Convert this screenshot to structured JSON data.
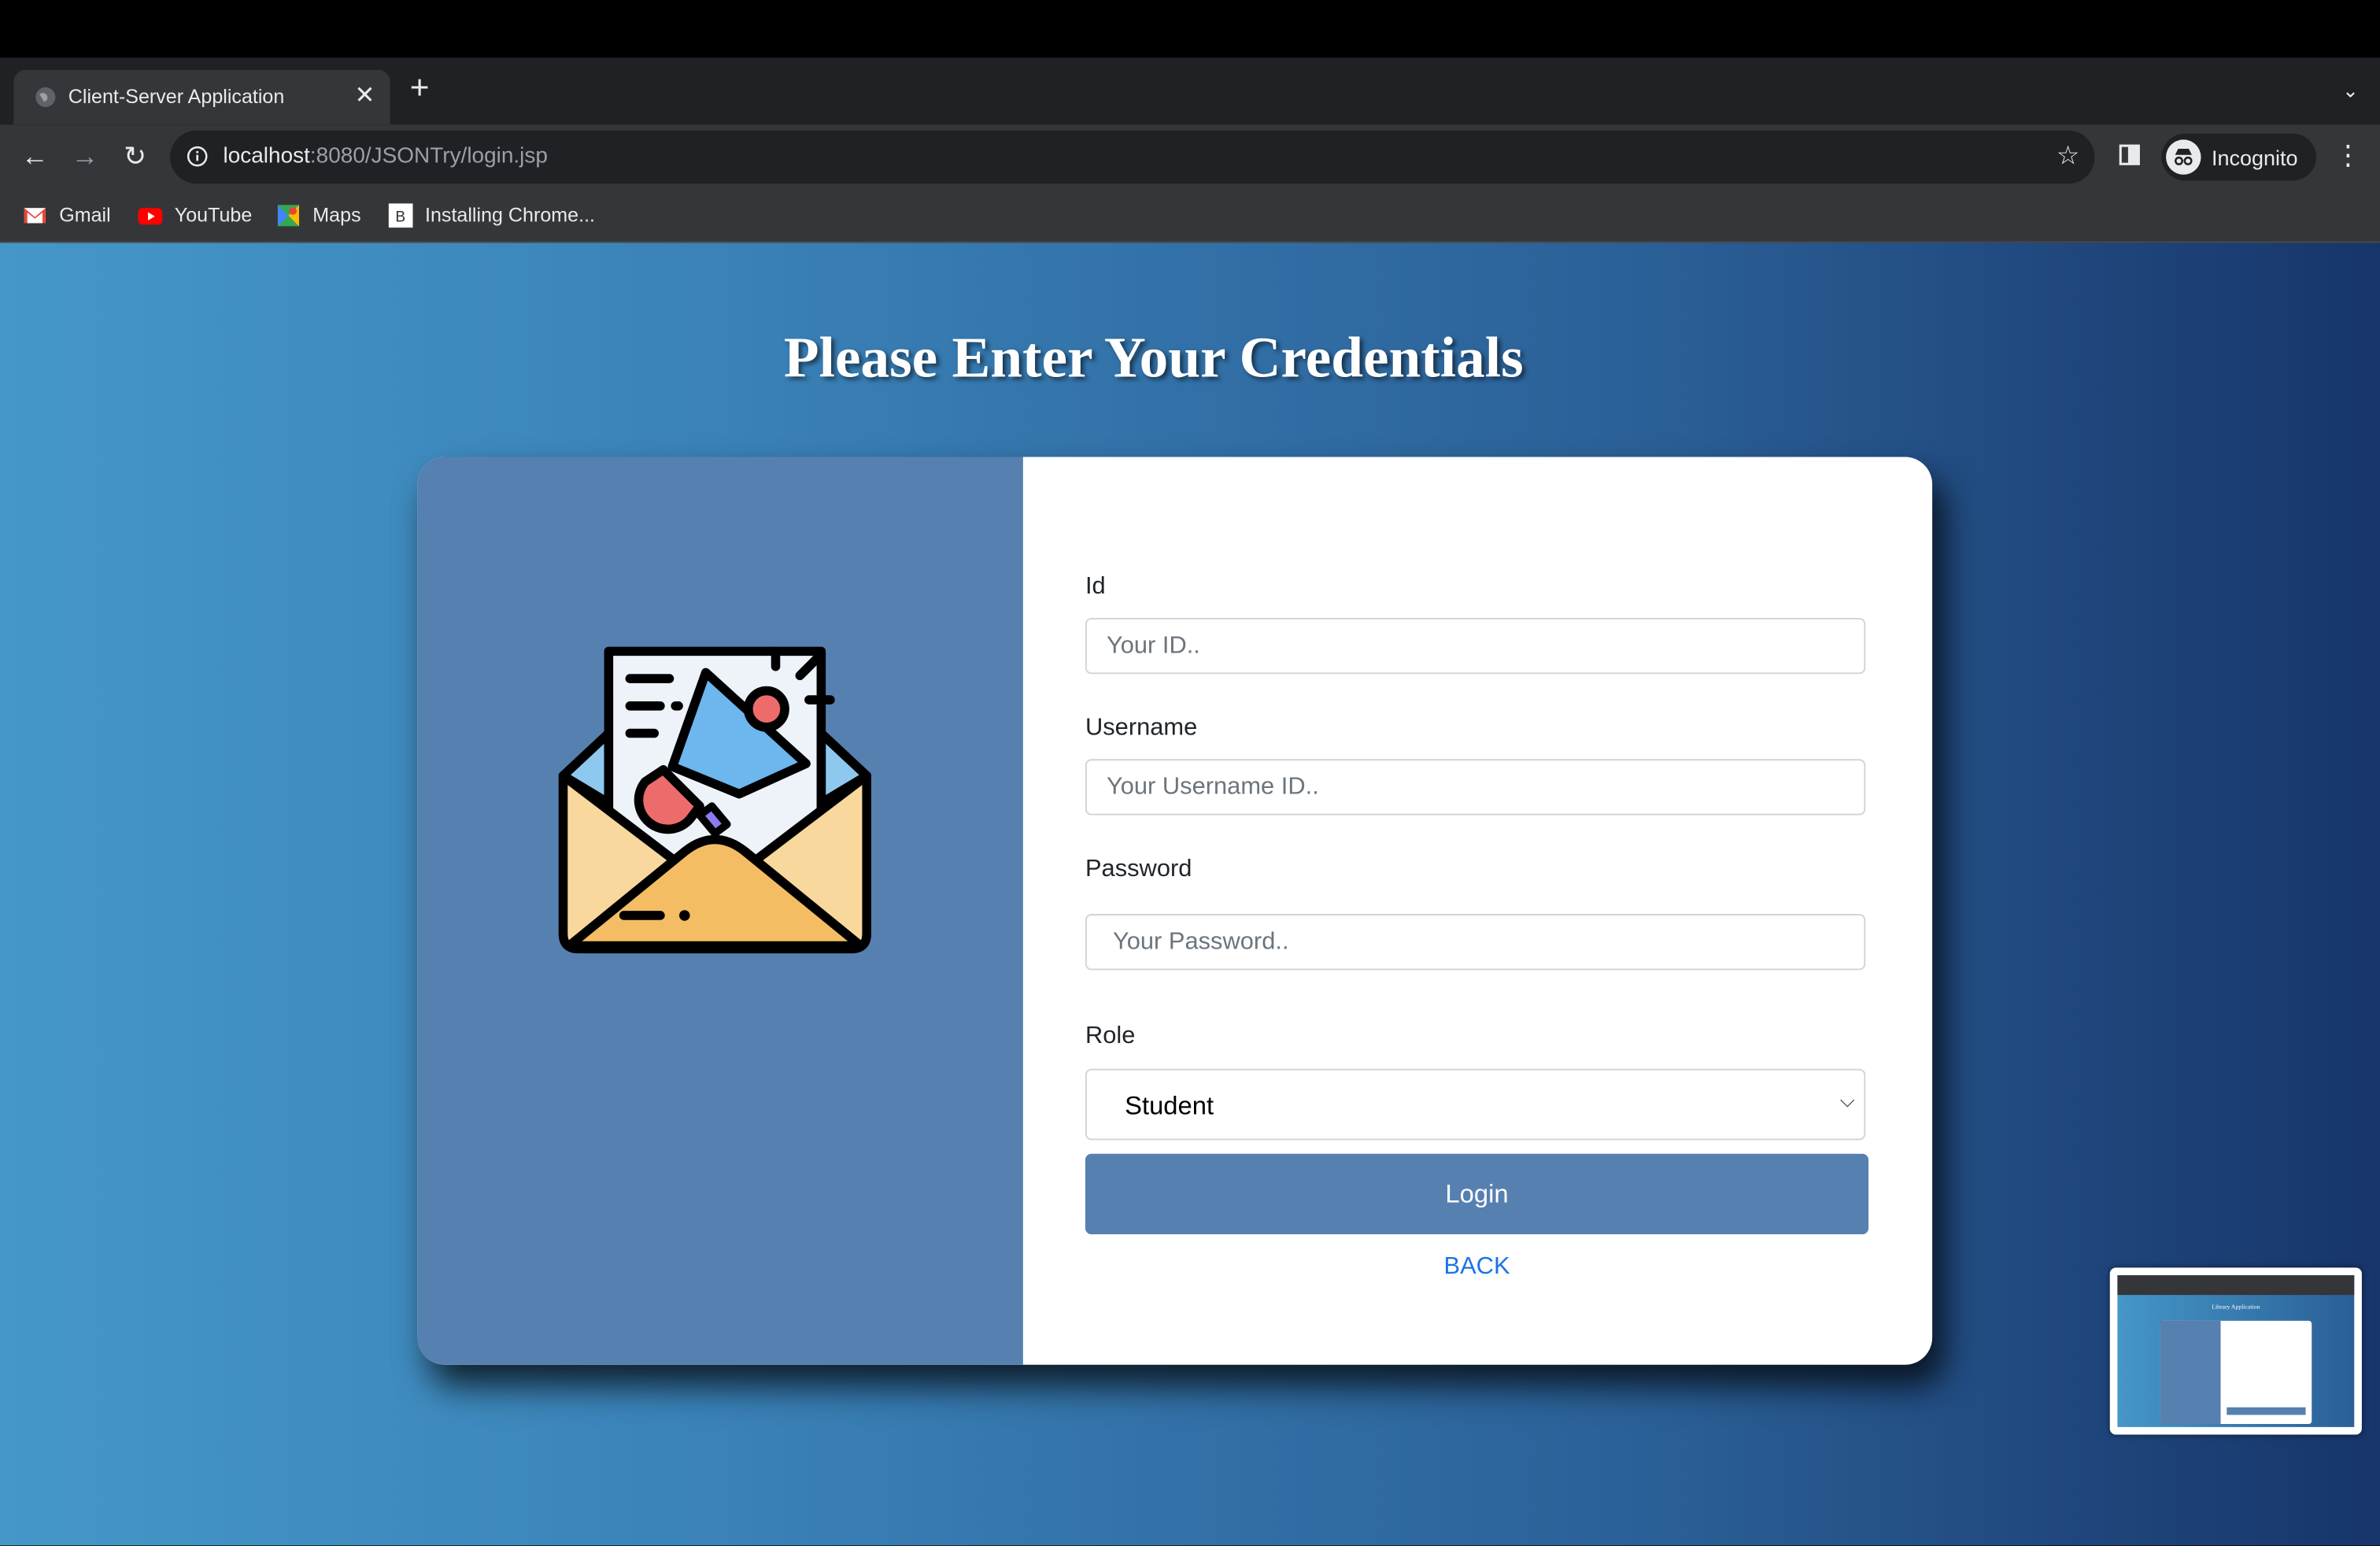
{
  "browser": {
    "tab_title": "Client-Server Application",
    "tab_close": "✕",
    "new_tab": "+",
    "tab_list": "⌄",
    "nav": {
      "back": "←",
      "forward": "→",
      "reload": "↻"
    },
    "url_host": "localhost",
    "url_path": ":8080/JSONTry/login.jsp",
    "star": "☆",
    "profile_label": "Incognito",
    "menu": "⋮"
  },
  "bookmarks": [
    {
      "label": "Gmail",
      "icon": "gmail-icon"
    },
    {
      "label": "YouTube",
      "icon": "youtube-icon"
    },
    {
      "label": "Maps",
      "icon": "maps-icon"
    },
    {
      "label": "Installing Chrome...",
      "icon": "page-b-icon"
    }
  ],
  "page": {
    "heading": "Please Enter Your Credentials",
    "form": {
      "id_label": "Id",
      "id_placeholder": "Your  ID..",
      "username_label": "Username",
      "username_placeholder": "Your Username ID..",
      "password_label": "Password",
      "password_placeholder": " Your Password..",
      "role_label": "Role",
      "role_value": "Student",
      "login_label": "Login",
      "back_label": "BACK"
    },
    "illustration_icon": "mail-megaphone-icon"
  },
  "thumbnail": {
    "title": "Library Application"
  },
  "colors": {
    "accent": "#5680b0",
    "link": "#1a73e8",
    "gradient_start": "#4597c8",
    "gradient_end": "#17356a"
  }
}
